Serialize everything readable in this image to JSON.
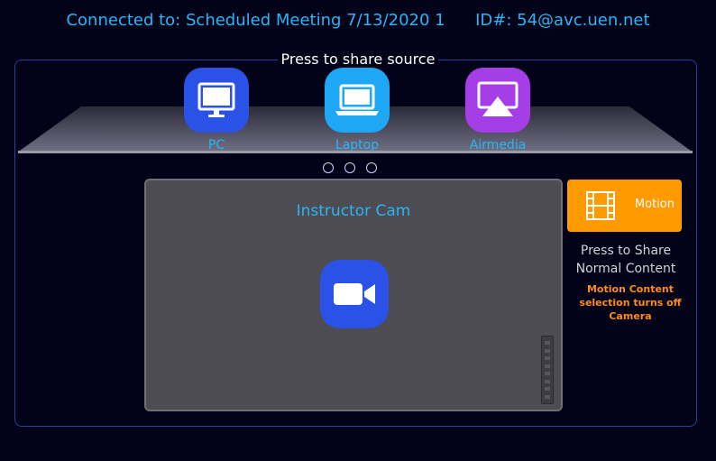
{
  "header": {
    "connected_label": "Connected to:",
    "meeting_name": "Scheduled Meeting 7/13/2020 1",
    "id_label": "ID#:",
    "id_value": "54@avc.uen.net"
  },
  "share": {
    "title": "Press to share source",
    "sources": [
      {
        "label": "PC",
        "icon": "monitor-icon",
        "color": "#2a52e6"
      },
      {
        "label": "Laptop",
        "icon": "laptop-icon",
        "color": "#1ea7f5"
      },
      {
        "label": "Airmedia",
        "icon": "airplay-icon",
        "color": "#a63ee8"
      }
    ],
    "page_dots": 3
  },
  "camera": {
    "title": "Instructor Cam",
    "icon": "video-camera-icon",
    "icon_color": "#2a52e6"
  },
  "content": {
    "motion_label": "Motion",
    "motion_color": "#ff9a00",
    "share_normal_line1": "Press to Share",
    "share_normal_line2": "Normal Content",
    "warning_line1": "Motion Content",
    "warning_line2": "selection turns off",
    "warning_line3": "Camera",
    "warning_color": "#ff8c1a"
  },
  "colors": {
    "accent": "#29b6f6",
    "background": "#020218",
    "panel_border": "#2c3f9a"
  }
}
